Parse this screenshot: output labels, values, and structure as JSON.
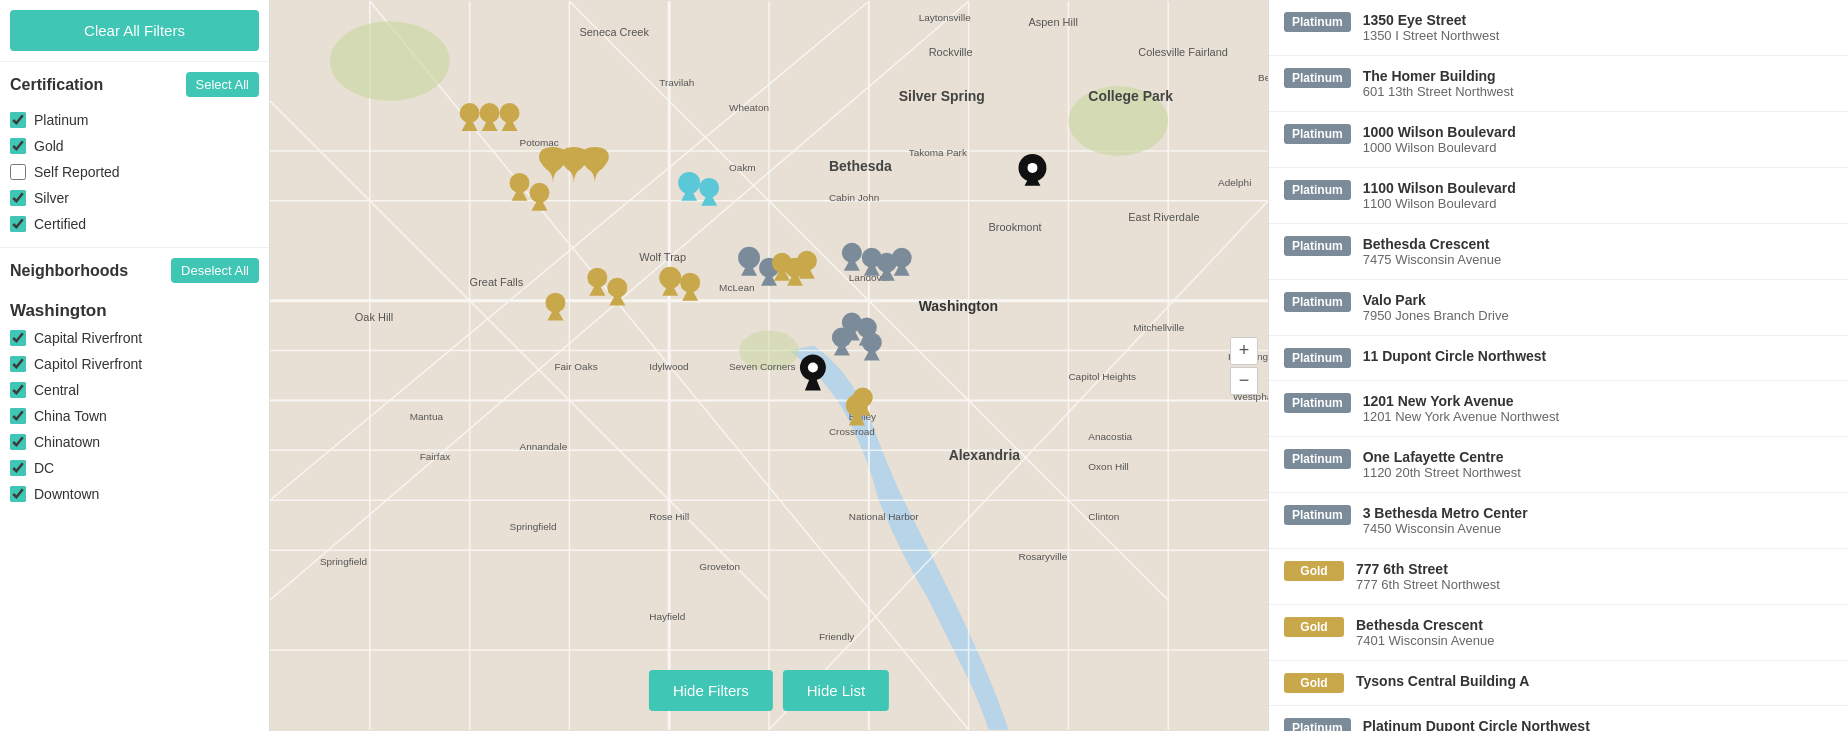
{
  "sidebar": {
    "clearFilters": "Clear All Filters",
    "certification": {
      "title": "Certification",
      "selectAll": "Select All",
      "items": [
        {
          "label": "Platinum",
          "checked": true
        },
        {
          "label": "Gold",
          "checked": true
        },
        {
          "label": "Self Reported",
          "checked": false
        },
        {
          "label": "Silver",
          "checked": true
        },
        {
          "label": "Certified",
          "checked": true
        }
      ]
    },
    "neighborhoods": {
      "title": "Neighborhoods",
      "deselectAll": "Deselect All",
      "groups": [
        {
          "name": "Washington",
          "items": [
            {
              "label": "Capital Riverfront",
              "checked": true
            },
            {
              "label": "Capitol Riverfront",
              "checked": true
            },
            {
              "label": "Central",
              "checked": true
            },
            {
              "label": "China Town",
              "checked": true
            },
            {
              "label": "Chinatown",
              "checked": true
            },
            {
              "label": "DC",
              "checked": true
            },
            {
              "label": "Downtown",
              "checked": true
            }
          ]
        }
      ]
    }
  },
  "bottomButtons": {
    "hideFilters": "Hide Filters",
    "hideList": "Hide List"
  },
  "mapControls": {
    "zoomIn": "+",
    "zoomOut": "−"
  },
  "listings": [
    {
      "badge": "Platinum",
      "name": "1350 Eye Street",
      "address": "1350 I Street Northwest"
    },
    {
      "badge": "Platinum",
      "name": "The Homer Building",
      "address": "601 13th Street Northwest"
    },
    {
      "badge": "Platinum",
      "name": "1000 Wilson Boulevard",
      "address": "1000 Wilson Boulevard"
    },
    {
      "badge": "Platinum",
      "name": "1100 Wilson Boulevard",
      "address": "1100 Wilson Boulevard"
    },
    {
      "badge": "Platinum",
      "name": "Bethesda Crescent",
      "address": "7475 Wisconsin Avenue"
    },
    {
      "badge": "Platinum",
      "name": "Valo Park",
      "address": "7950 Jones Branch Drive"
    },
    {
      "badge": "Platinum",
      "name": "11 Dupont Circle Northwest",
      "address": ""
    },
    {
      "badge": "Platinum",
      "name": "1201 New York Avenue",
      "address": "1201 New York Avenue Northwest"
    },
    {
      "badge": "Platinum",
      "name": "One Lafayette Centre",
      "address": "1120 20th Street Northwest"
    },
    {
      "badge": "Platinum",
      "name": "3 Bethesda Metro Center",
      "address": "7450 Wisconsin Avenue"
    },
    {
      "badge": "Gold",
      "name": "777 6th Street",
      "address": "777 6th Street Northwest"
    },
    {
      "badge": "Gold",
      "name": "Bethesda Crescent",
      "address": "7401 Wisconsin Avenue"
    },
    {
      "badge": "Gold",
      "name": "Tysons Central Building A",
      "address": ""
    },
    {
      "badge": "Platinum",
      "name": "Platinum Dupont Circle Northwest",
      "address": ""
    }
  ]
}
